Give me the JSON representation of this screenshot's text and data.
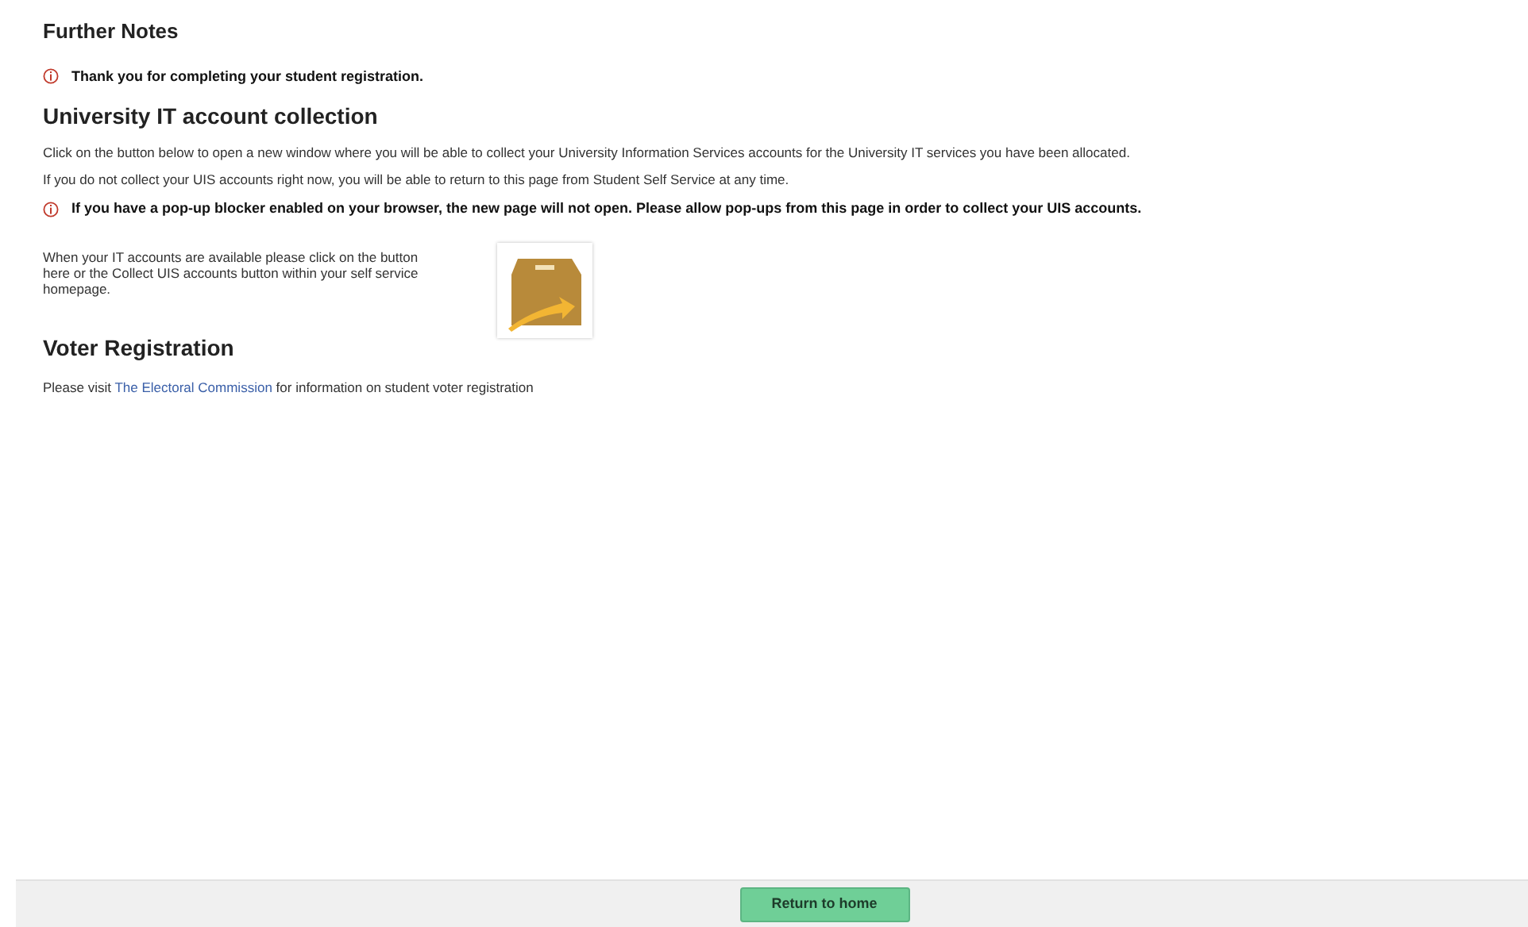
{
  "further_notes": {
    "heading": "Further Notes",
    "notice": "Thank you for completing your student registration."
  },
  "it_accounts": {
    "heading": "University IT account collection",
    "paragraphs": [
      "Click on the button below to open a new window where you will be able to collect your University Information Services accounts for the University IT services you have been allocated.",
      "If you do not collect your UIS accounts right now, you will be able to return to this page from Student Self Service at any time."
    ],
    "warning": "If you have a pop-up blocker enabled on your browser, the new page will not open. Please allow pop-ups from this page in order to collect your UIS accounts.",
    "collect_text": "When your IT accounts are available please click on the button here or the Collect UIS accounts button within your self service homepage."
  },
  "voter": {
    "heading": "Voter Registration",
    "text_before": "Please visit",
    "link": "The Electoral Commission",
    "text_after": "for information on student voter registration"
  },
  "footer": {
    "button": "Return to home"
  }
}
